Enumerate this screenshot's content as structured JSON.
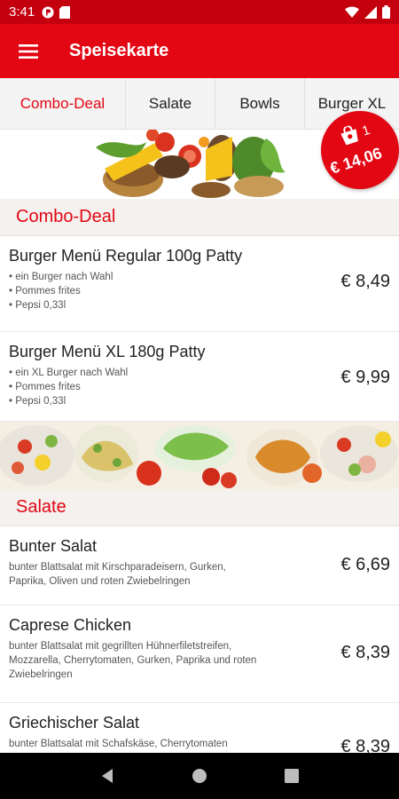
{
  "status_bar": {
    "time": "3:41"
  },
  "app_bar": {
    "title": "Speisekarte"
  },
  "tabs": [
    {
      "label": "Combo-Deal",
      "active": true
    },
    {
      "label": "Salate",
      "active": false
    },
    {
      "label": "Bowls",
      "active": false
    },
    {
      "label": "Burger XL",
      "active": false
    }
  ],
  "sections": {
    "combo": {
      "title": "Combo-Deal",
      "items": [
        {
          "name": "Burger Menü Regular 100g Patty",
          "desc": [
            "• ein Burger nach Wahl",
            "• Pommes frites",
            "• Pepsi 0,33l"
          ],
          "price": "€ 8,49"
        },
        {
          "name": "Burger Menü XL 180g Patty",
          "desc": [
            "• ein XL Burger nach Wahl",
            "• Pommes frites",
            "• Pepsi 0,33l"
          ],
          "price": "€ 9,99"
        }
      ]
    },
    "salate": {
      "title": "Salate",
      "items": [
        {
          "name": "Bunter Salat",
          "desc": [
            "bunter Blattsalat mit Kirschparadeisern, Gurken,",
            "Paprika, Oliven und roten Zwiebelringen"
          ],
          "price": "€ 6,69"
        },
        {
          "name": "Caprese Chicken",
          "desc": [
            "bunter Blattsalat mit gegrillten Hühnerfiletstreifen,",
            "Mozzarella, Cherrytomaten, Gurken, Paprika und roten",
            "Zwiebelringen"
          ],
          "price": "€ 8,39"
        },
        {
          "name": "Griechischer Salat",
          "desc": [
            "bunter Blattsalat mit Schafskäse, Cherrytomaten"
          ],
          "price": "€ 8,39"
        }
      ]
    }
  },
  "cart": {
    "count": "1",
    "total": "€ 14,06"
  },
  "colors": {
    "primary": "#e30613",
    "status_bar": "#c4000e",
    "section_bg": "#f4f1ee"
  }
}
